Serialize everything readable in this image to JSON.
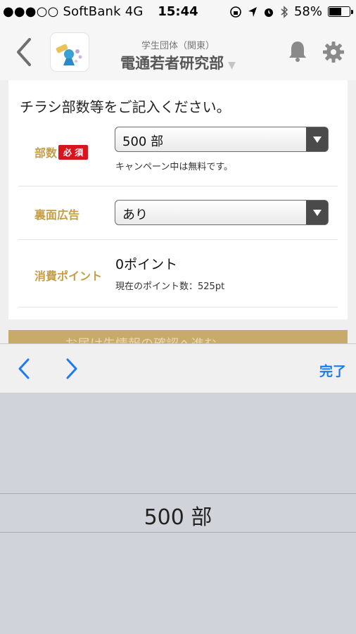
{
  "status_bar": {
    "carrier": "●●●○○ SoftBank  4G",
    "time": "15:44",
    "battery": "58%",
    "battery_level": 0.58
  },
  "header": {
    "subtitle": "学生団体（関東）",
    "title": "電通若者研究部"
  },
  "form": {
    "heading": "チラシ部数等をご記入ください。",
    "copies": {
      "label": "部数",
      "required_badge": "必 須",
      "value": "500 部",
      "note": "キャンペーン中は無料です。"
    },
    "back_ad": {
      "label": "裏面広告",
      "value": "あり"
    },
    "points": {
      "label": "消費ポイント",
      "value": "0ポイント",
      "current": "現在のポイント数：525pt"
    }
  },
  "gold_bar_text": "お届け先情報の確認へ進む",
  "toolbar": {
    "done": "完了"
  },
  "picker": {
    "selected": "500 部"
  },
  "colors": {
    "accent_label": "#c79d45",
    "required": "#d9151c",
    "ios_blue": "#1b7bf3",
    "gold_bar": "#c8aa6b"
  }
}
